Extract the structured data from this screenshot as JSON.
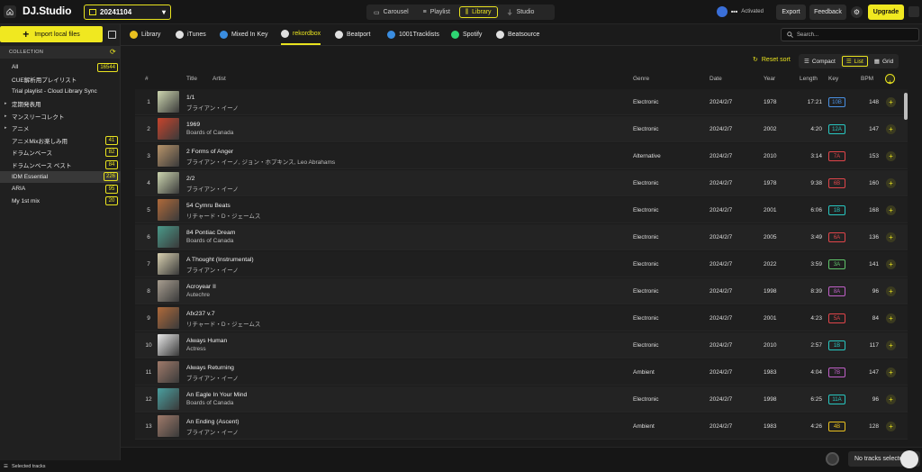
{
  "app": {
    "logo": "DJ.Studio",
    "project_name": "20241104"
  },
  "modes": [
    {
      "label": "Carousel",
      "active": false
    },
    {
      "label": "Playlist",
      "active": false
    },
    {
      "label": "Library",
      "active": true
    },
    {
      "label": "Studio",
      "active": false
    }
  ],
  "header": {
    "activated_label": "Activated",
    "export_label": "Export",
    "feedback_label": "Feedback",
    "upgrade_label": "Upgrade"
  },
  "sidebar": {
    "import_label": "Import local files",
    "collection_label": "COLLECTION",
    "items": [
      {
        "label": "All",
        "count": "16544",
        "selected": false,
        "expandable": false
      },
      {
        "label": "CUE解析用プレイリスト",
        "count": "",
        "selected": true,
        "expandable": false
      },
      {
        "label": "Trial playlist - Cloud Library Sync",
        "count": "",
        "selected": false,
        "expandable": false
      },
      {
        "label": "定期発表用",
        "count": "",
        "selected": false,
        "expandable": true
      },
      {
        "label": "マンスリーコレクト",
        "count": "",
        "selected": false,
        "expandable": true
      },
      {
        "label": "アニメ",
        "count": "",
        "selected": false,
        "expandable": true
      },
      {
        "label": "アニメMixお楽しみ用",
        "count": "41",
        "selected": false,
        "expandable": false
      },
      {
        "label": "ドラムンベース",
        "count": "82",
        "selected": false,
        "expandable": false
      },
      {
        "label": "ドラムンベース ベスト",
        "count": "84",
        "selected": false,
        "expandable": false
      },
      {
        "label": "IDM Essential",
        "count": "226",
        "selected": true,
        "expandable": false
      },
      {
        "label": "ARIA",
        "count": "95",
        "selected": false,
        "expandable": false
      },
      {
        "label": "My 1st mix",
        "count": "20",
        "selected": false,
        "expandable": false
      }
    ],
    "footer_label": "Selected tracks"
  },
  "sources": [
    {
      "label": "",
      "icon": "home-icon",
      "active": false
    },
    {
      "label": "Library",
      "icon": "music-note-icon",
      "active": false
    },
    {
      "label": "iTunes",
      "icon": "itunes-icon",
      "active": false
    },
    {
      "label": "Mixed In Key",
      "icon": "mixed-in-key-icon",
      "active": false
    },
    {
      "label": "rekordbox",
      "icon": "rekordbox-icon",
      "active": true
    },
    {
      "label": "Beatport",
      "icon": "beatport-icon",
      "active": false
    },
    {
      "label": "1001Tracklists",
      "icon": "tracklists-icon",
      "active": false
    },
    {
      "label": "Spotify",
      "icon": "spotify-icon",
      "active": false
    },
    {
      "label": "Beatsource",
      "icon": "beatsource-icon",
      "active": false
    }
  ],
  "search": {
    "placeholder": "Search..."
  },
  "view": {
    "reset_sort_label": "Reset sort",
    "compact_label": "Compact",
    "list_label": "List",
    "grid_label": "Grid"
  },
  "table": {
    "columns": {
      "num": "#",
      "title": "Title",
      "artist": "Artist",
      "genre": "Genre",
      "date": "Date",
      "year": "Year",
      "length": "Length",
      "key": "Key",
      "bpm": "BPM"
    },
    "rows": [
      {
        "num": "1",
        "title": "1/1",
        "artist": "ブライアン・イーノ",
        "genre": "Electronic",
        "date": "2024/2/7",
        "year": "1978",
        "length": "17:21",
        "key": "10B",
        "key_color": "#4a90e2",
        "bpm": "148",
        "art_color": "#cdd6b0"
      },
      {
        "num": "2",
        "title": "1969",
        "artist": "Boards of Canada",
        "genre": "Electronic",
        "date": "2024/2/7",
        "year": "2002",
        "length": "4:20",
        "key": "12A",
        "key_color": "#28c6c0",
        "bpm": "147",
        "art_color": "#c8442c"
      },
      {
        "num": "3",
        "title": "2 Forms of Anger",
        "artist": "ブライアン・イーノ, ジョン・ホプキンス, Leo Abrahams",
        "genre": "Alternative",
        "date": "2024/2/7",
        "year": "2010",
        "length": "3:14",
        "key": "7A",
        "key_color": "#e0454a",
        "bpm": "153",
        "art_color": "#b8946a"
      },
      {
        "num": "4",
        "title": "2/2",
        "artist": "ブライアン・イーノ",
        "genre": "Electronic",
        "date": "2024/2/7",
        "year": "1978",
        "length": "9:38",
        "key": "6B",
        "key_color": "#e0454a",
        "bpm": "160",
        "art_color": "#cdd6b0"
      },
      {
        "num": "5",
        "title": "54 Cymru Beats",
        "artist": "リチャード・D・ジェームス",
        "genre": "Electronic",
        "date": "2024/2/7",
        "year": "2001",
        "length": "6:06",
        "key": "1B",
        "key_color": "#28c6c0",
        "bpm": "168",
        "art_color": "#b06a3a"
      },
      {
        "num": "6",
        "title": "84 Pontiac Dream",
        "artist": "Boards of Canada",
        "genre": "Electronic",
        "date": "2024/2/7",
        "year": "2005",
        "length": "3:49",
        "key": "6A",
        "key_color": "#e0454a",
        "bpm": "136",
        "art_color": "#4a9a8a"
      },
      {
        "num": "7",
        "title": "A Thought (Instrumental)",
        "artist": "ブライアン・イーノ",
        "genre": "Electronic",
        "date": "2024/2/7",
        "year": "2022",
        "length": "3:59",
        "key": "3A",
        "key_color": "#5fc46a",
        "bpm": "141",
        "art_color": "#d8d0b0"
      },
      {
        "num": "8",
        "title": "Acroyear II",
        "artist": "Autechre",
        "genre": "Electronic",
        "date": "2024/2/7",
        "year": "1998",
        "length": "8:39",
        "key": "8A",
        "key_color": "#c060c8",
        "bpm": "96",
        "art_color": "#a89e90"
      },
      {
        "num": "9",
        "title": "Afx237 v.7",
        "artist": "リチャード・D・ジェームス",
        "genre": "Electronic",
        "date": "2024/2/7",
        "year": "2001",
        "length": "4:23",
        "key": "5A",
        "key_color": "#e0454a",
        "bpm": "84",
        "art_color": "#b06a3a"
      },
      {
        "num": "10",
        "title": "Always Human",
        "artist": "Actress",
        "genre": "Electronic",
        "date": "2024/2/7",
        "year": "2010",
        "length": "2:57",
        "key": "1B",
        "key_color": "#28c6c0",
        "bpm": "117",
        "art_color": "#e8e8e8"
      },
      {
        "num": "11",
        "title": "Always Returning",
        "artist": "ブライアン・イーノ",
        "genre": "Ambient",
        "date": "2024/2/7",
        "year": "1983",
        "length": "4:04",
        "key": "7B",
        "key_color": "#c060c8",
        "bpm": "147",
        "art_color": "#a07a6a"
      },
      {
        "num": "12",
        "title": "An Eagle In Your Mind",
        "artist": "Boards of Canada",
        "genre": "Electronic",
        "date": "2024/2/7",
        "year": "1998",
        "length": "6:25",
        "key": "11A",
        "key_color": "#28c6c0",
        "bpm": "96",
        "art_color": "#4aa0a0"
      },
      {
        "num": "13",
        "title": "An Ending (Ascent)",
        "artist": "ブライアン・イーノ",
        "genre": "Ambient",
        "date": "2024/2/7",
        "year": "1983",
        "length": "4:26",
        "key": "4B",
        "key_color": "#e9c01f",
        "bpm": "128",
        "art_color": "#a07a6a"
      }
    ]
  },
  "bottom": {
    "no_tracks_label": "No tracks selected"
  },
  "colors": {
    "accent": "#f0e820",
    "background": "#1b1b1b"
  }
}
